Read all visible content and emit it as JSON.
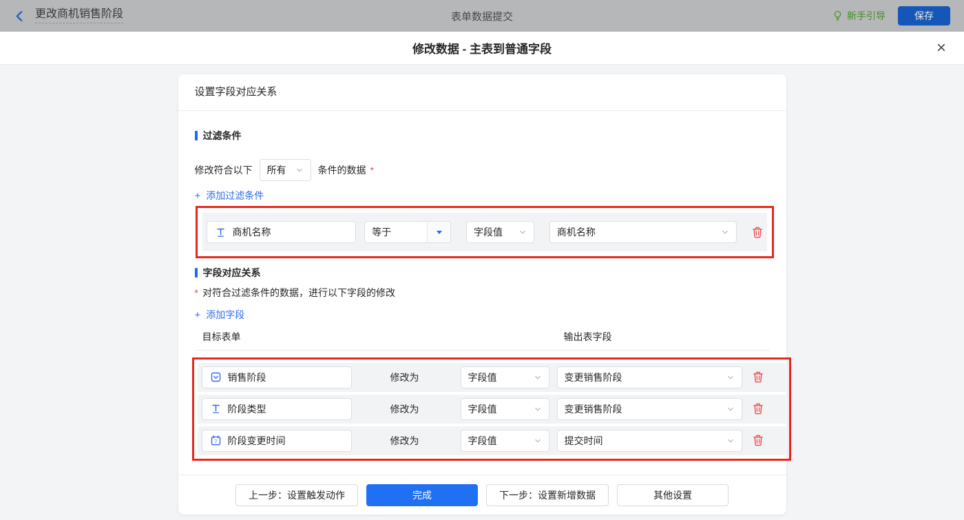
{
  "topbar": {
    "title": "更改商机销售阶段",
    "center_title": "表单数据提交",
    "guide_label": "新手引导",
    "save_label": "保存"
  },
  "modal": {
    "title": "修改数据 - 主表到普通字段",
    "close_icon": "×"
  },
  "card": {
    "header": "设置字段对应关系",
    "filter_section": {
      "title": "过滤条件",
      "match_prefix": "修改符合以下",
      "match_select_value": "所有",
      "match_suffix": "条件的数据",
      "required_mark": "*",
      "add_plus": "+",
      "add_label": "添加过滤条件",
      "condition": {
        "field": "商机名称",
        "operator": "等于",
        "value_type": "字段值",
        "value": "商机名称"
      }
    },
    "mapping_section": {
      "title": "字段对应关系",
      "required_mark": "*",
      "note": "对符合过滤条件的数据，进行以下字段的修改",
      "add_plus": "+",
      "add_label": "添加字段",
      "col_target": "目标表单",
      "col_output": "输出表字段",
      "rows": [
        {
          "field": "销售阶段",
          "field_type": "select",
          "modify_label": "修改为",
          "value_type": "字段值",
          "value": "变更销售阶段"
        },
        {
          "field": "阶段类型",
          "field_type": "text",
          "modify_label": "修改为",
          "value_type": "字段值",
          "value": "变更销售阶段"
        },
        {
          "field": "阶段变更时间",
          "field_type": "date",
          "modify_label": "修改为",
          "value_type": "字段值",
          "value": "提交时间"
        }
      ]
    },
    "footer": {
      "prev_label": "上一步：设置触发动作",
      "done_label": "完成",
      "next_label": "下一步：设置新增数据",
      "other_label": "其他设置"
    }
  },
  "icons": {
    "back": "chevron-left",
    "guide": "lightbulb",
    "close": "x-close",
    "field_text": "T-underline",
    "field_select": "box-with-chevron",
    "field_date": "calendar-7",
    "select_chevron": "chevron-down",
    "operator_caret": "filled-caret-down",
    "delete": "trash-can",
    "add": "plus"
  },
  "colors": {
    "accent_blue": "#2468f2",
    "link_blue": "#2e6bee",
    "primary_button_blue": "#2070f3",
    "annotation_red": "#e8271c",
    "delete_red": "#f14848",
    "required_red": "#f03e3e",
    "guide_green": "#3f9323",
    "topbar_bg": "#b6b7b9",
    "panel_gray": "#f2f3f5"
  }
}
